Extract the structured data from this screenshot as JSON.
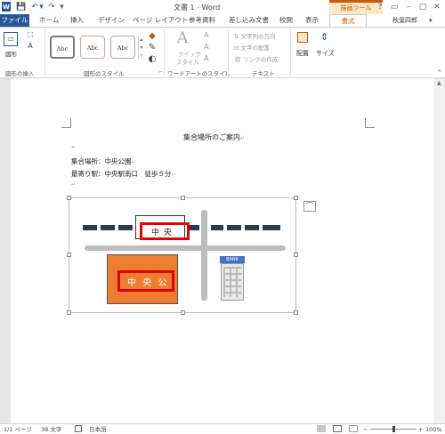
{
  "window": {
    "title": "文書 1 - Word",
    "context_tab_group": "描画ツール",
    "help": "?",
    "controls": {
      "ribbon_display": "▭",
      "minimize": "–",
      "restore": "▢",
      "close": "✕"
    }
  },
  "quick_access": {
    "app_icon": "W",
    "save": "💾",
    "undo": "↶",
    "undo_menu": "▾",
    "redo": "↷",
    "customize": "▾"
  },
  "tabs": [
    {
      "label": "ファイル"
    },
    {
      "label": "ホーム"
    },
    {
      "label": "挿入"
    },
    {
      "label": "デザイン"
    },
    {
      "label": "ページ レイアウト"
    },
    {
      "label": "参考資料"
    },
    {
      "label": "差し込み文書"
    },
    {
      "label": "校閲"
    },
    {
      "label": "表示"
    },
    {
      "label": "書式"
    }
  ],
  "user": {
    "name": "秋葉四郎",
    "menu": "▾"
  },
  "ribbon": {
    "insert_shapes": {
      "label": "図形の挿入",
      "edit_shape_button": "図形",
      "icons": [
        "▭",
        "⬚",
        "A"
      ]
    },
    "shape_styles": {
      "label": "図形のスタイル",
      "samples": [
        "Abc",
        "Abc",
        "Abc"
      ],
      "fill_icon": "◆",
      "outline_icon": "✎",
      "effect_icon": "◐",
      "launcher": "⌐"
    },
    "wordart": {
      "label": "ワードアートのスタイル",
      "quick_style_line1": "クイック",
      "quick_style_line2": "スタイル",
      "text_fill": "A",
      "text_outline": "A",
      "text_effect": "A",
      "launcher": "⌐"
    },
    "text": {
      "label": "テキスト",
      "direction": "文字列の方向",
      "align": "文字の配置",
      "link": "リンクの作成"
    },
    "arrange": {
      "label": "配置"
    },
    "size": {
      "label": "サイズ"
    },
    "collapse": "^"
  },
  "document": {
    "title": "集合場所のご案内",
    "line1": "集合場所：中央公園",
    "line2": "最寄り駅：中央駅南口　徒歩５分",
    "para_mark": "↵",
    "map": {
      "station_sign": "中 央",
      "park_label": "中 央 公",
      "bank_label": "BANK",
      "layout_options_icon": "⌒"
    }
  },
  "status": {
    "page": "1/1 ページ",
    "words": "38 文字",
    "language": "日本語",
    "zoom_out": "−",
    "zoom_in": "+",
    "zoom": "100%"
  }
}
